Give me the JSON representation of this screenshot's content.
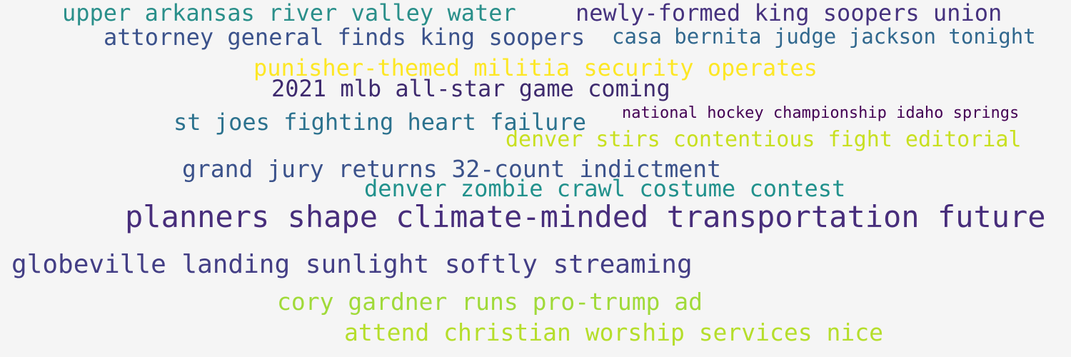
{
  "word_cloud": {
    "phrases": [
      {
        "text": "upper arkansas river valley water",
        "color": "#2a8f8a"
      },
      {
        "text": "newly-formed king soopers union",
        "color": "#46327e"
      },
      {
        "text": "attorney general finds king soopers",
        "color": "#3b528b"
      },
      {
        "text": "casa bernita judge jackson tonight",
        "color": "#31688e"
      },
      {
        "text": "punisher-themed militia security operates",
        "color": "#fde725"
      },
      {
        "text": "2021 mlb all-star game coming",
        "color": "#3e2a6e"
      },
      {
        "text": "st joes fighting heart failure",
        "color": "#2c728e"
      },
      {
        "text": "national hockey championship idaho springs",
        "color": "#440154"
      },
      {
        "text": "denver stirs contentious fight editorial",
        "color": "#c8e020"
      },
      {
        "text": "grand jury returns 32-count indictment",
        "color": "#3b528b"
      },
      {
        "text": "denver zombie crawl costume contest",
        "color": "#21918c"
      },
      {
        "text": "planners shape climate-minded transportation future",
        "color": "#472d7b"
      },
      {
        "text": "globeville landing sunlight softly streaming",
        "color": "#433e85"
      },
      {
        "text": "cory gardner runs pro-trump ad",
        "color": "#a0da39"
      },
      {
        "text": "attend christian worship services nice",
        "color": "#b5de2b"
      }
    ]
  }
}
